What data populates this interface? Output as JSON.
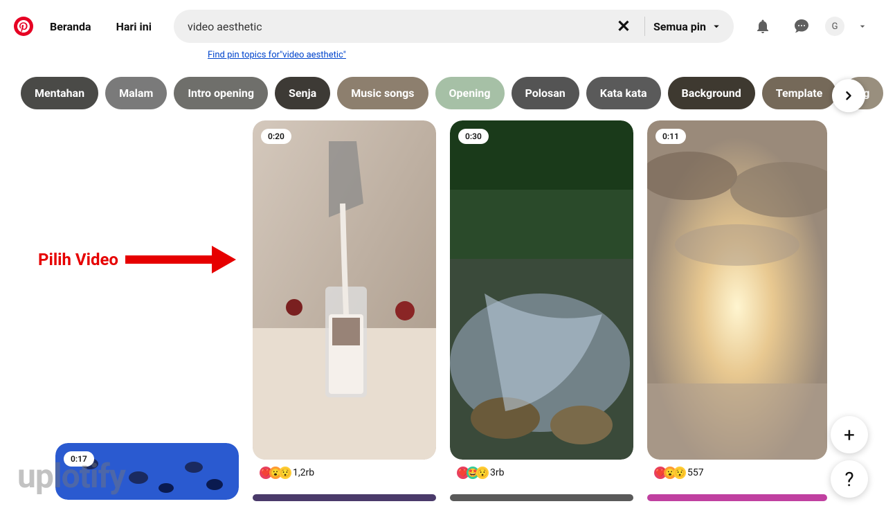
{
  "header": {
    "nav": {
      "home": "Beranda",
      "today": "Hari ini"
    },
    "search": {
      "value": "video aesthetic",
      "filter_label": "Semua pin"
    },
    "avatar_initial": "G",
    "topics_link": "Find pin topics for\"video aesthetic\""
  },
  "chips": [
    {
      "label": "Mentahan",
      "bg": "#4a4a47"
    },
    {
      "label": "Malam",
      "bg": "#7a7a7a"
    },
    {
      "label": "Intro opening",
      "bg": "#6f6f6b"
    },
    {
      "label": "Senja",
      "bg": "#3d3a35"
    },
    {
      "label": "Music songs",
      "bg": "#8d7f6e"
    },
    {
      "label": "Opening",
      "bg": "#a6c0a6"
    },
    {
      "label": "Polosan",
      "bg": "#545454"
    },
    {
      "label": "Kata kata",
      "bg": "#5a5a5a"
    },
    {
      "label": "Background",
      "bg": "#3e3930"
    },
    {
      "label": "Template",
      "bg": "#756959"
    },
    {
      "label": "ng",
      "bg": "#998f7e"
    }
  ],
  "pins": [
    {
      "duration": "0:20",
      "reactions": "1,2rb",
      "emojis": [
        "❤️",
        "😮",
        "😯"
      ]
    },
    {
      "duration": "0:30",
      "reactions": "3rb",
      "emojis": [
        "❤️",
        "🤩",
        "😯"
      ]
    },
    {
      "duration": "0:11",
      "reactions": "557",
      "emojis": [
        "❤️",
        "😮",
        "😯"
      ]
    },
    {
      "duration": "0:17"
    }
  ],
  "annotation": {
    "text": "Pilih Video"
  },
  "watermark": "uplotify",
  "fab": {
    "plus": "+",
    "help": "?"
  }
}
